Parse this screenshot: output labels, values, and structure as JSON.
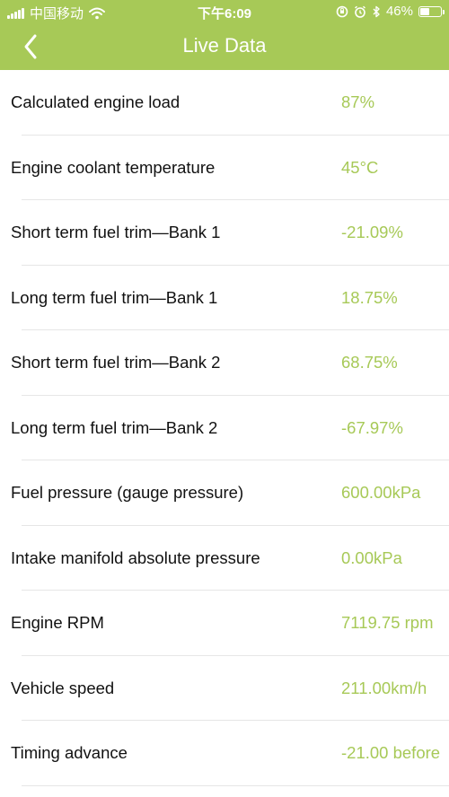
{
  "status_bar": {
    "carrier": "中国移动",
    "time": "下午6:09",
    "battery_percent": "46%",
    "battery_level": 0.46,
    "icons": [
      "signal-icon",
      "wifi-icon",
      "orientation-lock-icon",
      "alarm-icon",
      "bluetooth-icon",
      "battery-icon"
    ]
  },
  "nav": {
    "title": "Live Data",
    "back_icon": "chevron-left-icon"
  },
  "colors": {
    "header_bg": "#a7c957",
    "value_text": "#a7c957",
    "label_text": "#111111"
  },
  "items": [
    {
      "label": "Calculated engine load",
      "value": "87%"
    },
    {
      "label": "Engine coolant temperature",
      "value": "45°C"
    },
    {
      "label": "Short term fuel trim—Bank 1",
      "value": "-21.09%"
    },
    {
      "label": "Long term fuel trim—Bank 1",
      "value": "18.75%"
    },
    {
      "label": "Short term fuel trim—Bank 2",
      "value": "68.75%"
    },
    {
      "label": "Long term fuel trim—Bank 2",
      "value": "-67.97%"
    },
    {
      "label": "Fuel pressure (gauge pressure)",
      "value": "600.00kPa"
    },
    {
      "label": "Intake manifold absolute pressure",
      "value": "0.00kPa"
    },
    {
      "label": "Engine RPM",
      "value": "7119.75 rpm"
    },
    {
      "label": "Vehicle speed",
      "value": "211.00km/h"
    },
    {
      "label": "Timing advance",
      "value": "-21.00 before"
    }
  ]
}
